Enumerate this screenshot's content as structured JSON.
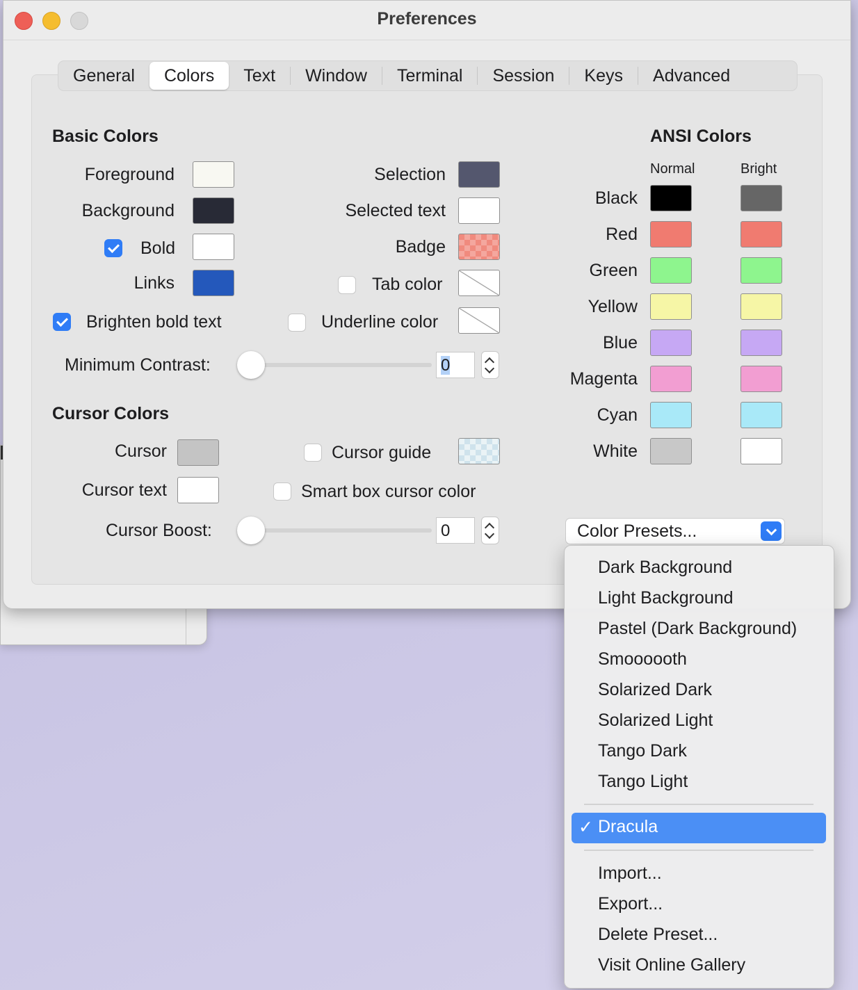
{
  "window": {
    "title": "Preferences"
  },
  "tabs": [
    "General",
    "Colors",
    "Text",
    "Window",
    "Terminal",
    "Session",
    "Keys",
    "Advanced"
  ],
  "basic": {
    "header": "Basic Colors",
    "foreground": "Foreground",
    "background": "Background",
    "bold": "Bold",
    "links": "Links",
    "brighten": "Brighten bold text",
    "selection": "Selection",
    "selected_text": "Selected text",
    "badge": "Badge",
    "tab_color": "Tab color",
    "underline_color": "Underline color",
    "min_contrast": "Minimum Contrast:",
    "min_contrast_value": "0"
  },
  "cursor": {
    "header": "Cursor Colors",
    "cursor": "Cursor",
    "cursor_text": "Cursor text",
    "cursor_guide": "Cursor guide",
    "smart_box": "Smart box cursor color",
    "boost": "Cursor Boost:",
    "boost_value": "0"
  },
  "ansi": {
    "header": "ANSI Colors",
    "normal": "Normal",
    "bright": "Bright",
    "rows": [
      {
        "name": "Black",
        "normal": "#000000",
        "bright": "#666666"
      },
      {
        "name": "Red",
        "normal": "#f07b70",
        "bright": "#f07b70"
      },
      {
        "name": "Green",
        "normal": "#8ef58e",
        "bright": "#8ef58e"
      },
      {
        "name": "Yellow",
        "normal": "#f6f6a6",
        "bright": "#f6f6a6"
      },
      {
        "name": "Blue",
        "normal": "#c6a8f4",
        "bright": "#c6a8f4"
      },
      {
        "name": "Magenta",
        "normal": "#f29ed2",
        "bright": "#f29ed2"
      },
      {
        "name": "Cyan",
        "normal": "#a9e9f8",
        "bright": "#a9e9f8"
      },
      {
        "name": "White",
        "normal": "#c8c8c8",
        "bright": "#ffffff"
      }
    ]
  },
  "presets": {
    "button": "Color Presets...",
    "items": [
      "Dark Background",
      "Light Background",
      "Pastel (Dark Background)",
      "Smoooooth",
      "Solarized Dark",
      "Solarized Light",
      "Tango Dark",
      "Tango Light"
    ],
    "selected": "Dracula",
    "actions": [
      "Import...",
      "Export...",
      "Delete Preset...",
      "Visit Online Gallery"
    ]
  },
  "colors": {
    "foreground": "#f8f8f2",
    "background": "#282a36",
    "bold": "#ffffff",
    "links": "#2458bb",
    "selection": "#54576e",
    "selected_text": "#ffffff",
    "badge": "#f08a7e",
    "cursor": "#c4c4c4",
    "cursor_text": "#ffffff",
    "accent": "#2f7cf6",
    "menu_highlight": "#4b8ff5"
  }
}
